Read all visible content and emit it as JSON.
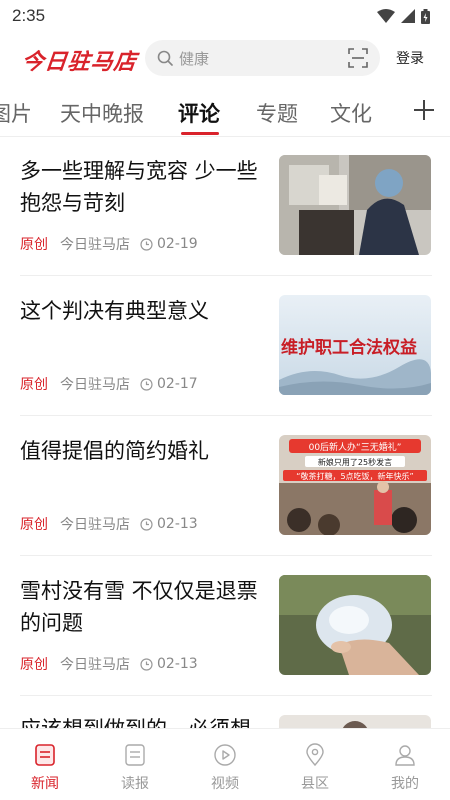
{
  "status_bar": {
    "time": "2:35"
  },
  "header": {
    "logo_text": "今日驻马店",
    "search_placeholder": "健康",
    "login_label": "登录"
  },
  "tabs": [
    {
      "label": "图片"
    },
    {
      "label": "天中晚报"
    },
    {
      "label": "评论",
      "active": true
    },
    {
      "label": "专题"
    },
    {
      "label": "文化"
    }
  ],
  "articles": [
    {
      "title": "多一些理解与宽容  少一些抱怨与苛刻",
      "badge": "原创",
      "source": "今日驻马店",
      "date": "02-19"
    },
    {
      "title": "这个判决有典型意义",
      "badge": "原创",
      "source": "今日驻马店",
      "date": "02-17",
      "thumb_text": "维护职工合法权益"
    },
    {
      "title": "值得提倡的简约婚礼",
      "badge": "原创",
      "source": "今日驻马店",
      "date": "02-13",
      "thumb_text_1": "00后新人办“三无婚礼”",
      "thumb_text_2": "新娘只用了25秒发言",
      "thumb_text_3": "“敬茶打糖，5点吃饭，新年快乐”"
    },
    {
      "title": "雪村没有雪  不仅仅是退票的问题",
      "badge": "原创",
      "source": "今日驻马店",
      "date": "02-13"
    },
    {
      "title": "应该想到做到的，必须想"
    }
  ],
  "bottom_nav": [
    {
      "label": "新闻",
      "icon": "news-icon",
      "active": true
    },
    {
      "label": "读报",
      "icon": "newspaper-icon"
    },
    {
      "label": "视频",
      "icon": "video-icon"
    },
    {
      "label": "县区",
      "icon": "location-icon"
    },
    {
      "label": "我的",
      "icon": "profile-icon"
    }
  ],
  "colors": {
    "accent": "#d9232b",
    "text": "#111111",
    "muted": "#888888"
  }
}
